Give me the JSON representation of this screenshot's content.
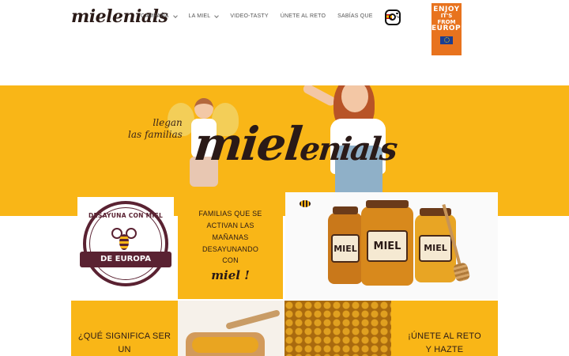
{
  "header": {
    "logo": "mielenials",
    "nav": [
      {
        "label": "CAMPAÑA",
        "dropdown": true
      },
      {
        "label": "LA MIEL",
        "dropdown": true
      },
      {
        "label": "VIDEO-TASTY",
        "dropdown": false
      },
      {
        "label": "ÚNETE AL RETO",
        "dropdown": false
      },
      {
        "label": "SABÍAS QUE",
        "dropdown": false
      }
    ],
    "language_icon": "spain-flag-icon",
    "social_icon": "instagram-icon",
    "eu_badge": {
      "line1": "ENJOY",
      "line2": "IT'S FROM",
      "line3": "EUROPE"
    }
  },
  "hero": {
    "tagline_1": "llegan",
    "tagline_2": "las familias",
    "wordmark_main": "miel",
    "wordmark_rest": "enials"
  },
  "tiles": {
    "seal": {
      "top": "DESAYUNA CON MIEL",
      "band": "DE EUROPA"
    },
    "breakfast": {
      "line1": "FAMILIAS QUE SE",
      "line2": "ACTIVAN LAS",
      "line3": "MAÑANAS",
      "line4": "DESAYUNANDO",
      "line5": "CON",
      "script": "miel !"
    },
    "jars": {
      "label_left": "MIEL",
      "label_center": "MIEL",
      "label_right": "MIEL"
    },
    "meaning": {
      "line1": "¿QUÉ SIGNIFICA SER",
      "line2": "UN"
    },
    "challenge": {
      "line1": "¡ÚNETE AL RETO",
      "line2": "Y HAZTE"
    }
  },
  "colors": {
    "accent": "#f9b617",
    "brand_dark": "#2a1a17",
    "seal": "#5a2232",
    "eu_orange": "#e8731e"
  }
}
